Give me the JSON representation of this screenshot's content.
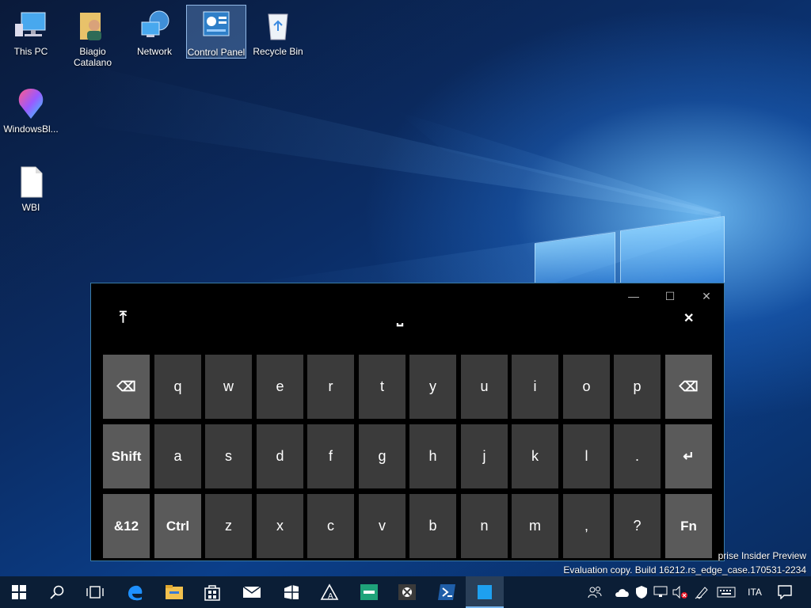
{
  "desktop": {
    "icons": [
      {
        "label": "This PC"
      },
      {
        "label": "Biagio Catalano"
      },
      {
        "label": "Network"
      },
      {
        "label": "Control Panel"
      },
      {
        "label": "Recycle Bin"
      },
      {
        "label": "WindowsBl..."
      },
      {
        "label": "WBI"
      }
    ]
  },
  "keyboard": {
    "toolbar": {
      "dock_glyph": "⤒",
      "space_glyph": "⎵",
      "close_glyph": "✕"
    },
    "window_controls": {
      "minimize": "—",
      "maximize": "☐",
      "close": "✕"
    },
    "rows": [
      [
        "⌫",
        "q",
        "w",
        "e",
        "r",
        "t",
        "y",
        "u",
        "i",
        "o",
        "p",
        "⌫"
      ],
      [
        "Shift",
        "a",
        "s",
        "d",
        "f",
        "g",
        "h",
        "j",
        "k",
        "l",
        ".",
        "↵"
      ],
      [
        "&12",
        "Ctrl",
        "z",
        "x",
        "c",
        "v",
        "b",
        "n",
        "m",
        ",",
        "?",
        "Fn"
      ]
    ]
  },
  "watermark": {
    "line1": "prise Insider Preview",
    "line2": "Evaluation copy. Build 16212.rs_edge_case.170531-2234"
  },
  "taskbar": {
    "language": "ITA"
  },
  "colors": {
    "taskbar": "#0b1e36",
    "key": "#3b3b3b",
    "function_key": "#5a5a5a",
    "accent": "#7ab8f0"
  }
}
